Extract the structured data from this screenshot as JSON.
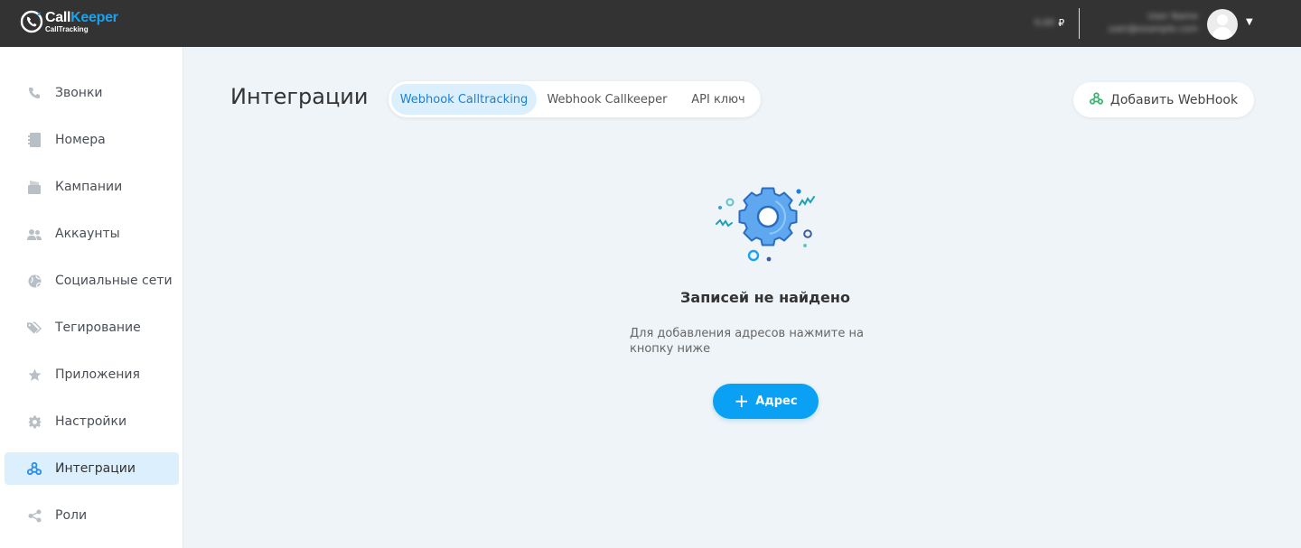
{
  "header": {
    "logo": {
      "brand_part1": "Call",
      "brand_part2": "Keeper",
      "sub": "CallTracking"
    },
    "balance": {
      "amount": "0,00",
      "currency": "₽"
    },
    "user": {
      "name": "User Name",
      "email": "user@example.com"
    },
    "colors": {
      "bar": "#333333",
      "brand_accent": "#17a3f0"
    }
  },
  "sidebar": {
    "items": [
      {
        "label": "Звонки",
        "icon": "phone-icon"
      },
      {
        "label": "Номера",
        "icon": "numbers-icon"
      },
      {
        "label": "Кампании",
        "icon": "campaign-icon"
      },
      {
        "label": "Аккаунты",
        "icon": "users-icon"
      },
      {
        "label": "Социальные сети",
        "icon": "globe-icon"
      },
      {
        "label": "Тегирование",
        "icon": "tags-icon"
      },
      {
        "label": "Приложения",
        "icon": "star-icon"
      },
      {
        "label": "Настройки",
        "icon": "gear-icon"
      },
      {
        "label": "Интеграции",
        "icon": "webhook-icon",
        "active": true
      },
      {
        "label": "Роли",
        "icon": "share-icon"
      }
    ]
  },
  "main": {
    "title": "Интеграции",
    "tabs": [
      {
        "label": "Webhook Calltracking",
        "active": true
      },
      {
        "label": "Webhook Callkeeper"
      },
      {
        "label": "API ключ"
      }
    ],
    "add_webhook_label": "Добавить WebHook",
    "empty": {
      "title": "Записей не найдено",
      "description": "Для добавления адресов нажмите на кнопку ниже",
      "button_label": "Адрес",
      "illustration": "gear-settings-illustration"
    },
    "colors": {
      "primary": "#0aa1f5",
      "active_tab_bg": "#dceffd",
      "webhook_icon": "#3cb371"
    }
  }
}
